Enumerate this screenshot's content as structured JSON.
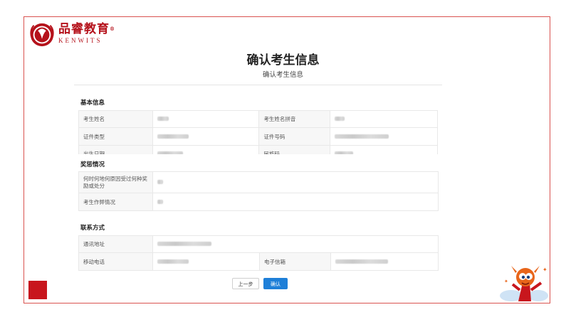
{
  "brand": {
    "name_cn": "品睿教育",
    "name_en": "KENWITS",
    "registered": "®"
  },
  "header": {
    "title": "确认考生信息",
    "subtitle": "确认考生信息"
  },
  "sections": {
    "basic": {
      "title": "基本信息",
      "labels": {
        "name": "考生姓名",
        "pinyin": "考生姓名拼音",
        "id_type": "证件类型",
        "id_number": "证件号码",
        "birth": "出生日期",
        "ethnicity": "民族码"
      }
    },
    "awards": {
      "title": "奖惩情况",
      "labels": {
        "awards": "何时何地何原因受过何种奖励或处分",
        "cheating": "考生作弊情况"
      }
    },
    "contact": {
      "title": "联系方式",
      "labels": {
        "address": "通讯地址",
        "mobile": "移动电话",
        "email": "电子信箱"
      }
    }
  },
  "buttons": {
    "prev": "上一步",
    "confirm": "确认"
  },
  "colors": {
    "brand_red": "#b5121b",
    "frame_border": "#d9534f",
    "primary_blue": "#1e7fd8",
    "accent_square": "#c8161d"
  }
}
